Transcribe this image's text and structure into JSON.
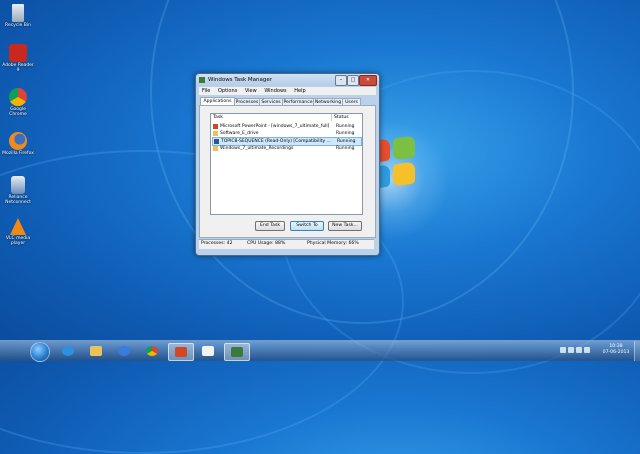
{
  "desktop": {
    "icons": [
      {
        "label": "Recycle Bin",
        "icon": "recycle-bin-icon"
      },
      {
        "label": "Adobe Reader 9",
        "icon": "adobe-reader-icon"
      },
      {
        "label": "Google Chrome",
        "icon": "chrome-icon"
      },
      {
        "label": "Mozilla Firefox",
        "icon": "firefox-icon"
      },
      {
        "label": "Reliance Netconnect",
        "icon": "netconnect-icon"
      },
      {
        "label": "VLC media player",
        "icon": "vlc-icon"
      }
    ]
  },
  "window": {
    "title": "Windows Task Manager",
    "menu": [
      "File",
      "Options",
      "View",
      "Windows",
      "Help"
    ],
    "tabs": [
      "Applications",
      "Processes",
      "Services",
      "Performance",
      "Networking",
      "Users"
    ],
    "active_tab": "Applications",
    "columns": {
      "task": "Task",
      "status": "Status"
    },
    "rows": [
      {
        "name": "Microsoft PowerPoint - [windows_7_ultimate_full]",
        "status": "Running"
      },
      {
        "name": "Software_E_drive",
        "status": "Running"
      },
      {
        "name": "TOPIC8-SEQUENCE (Read-Only) [Compatibility ...",
        "status": "Running"
      },
      {
        "name": "Windows_7_ultimate_Recordings",
        "status": "Running"
      }
    ],
    "buttons": {
      "end_task": "End Task",
      "switch_to": "Switch To",
      "new_task": "New Task..."
    },
    "status_bar": {
      "processes": "Processes: 42",
      "cpu": "CPU Usage: 88%",
      "memory": "Physical Memory: 66%"
    }
  },
  "taskbar": {
    "pinned": [
      "ie-icon",
      "explorer-icon",
      "media-player-icon",
      "chrome-icon",
      "powerpoint-icon",
      "paint-icon",
      "task-manager-icon"
    ],
    "clock_time": "10:38",
    "clock_date": "07-06-2013"
  },
  "colors": {
    "desktop": "#1a78d2",
    "window_frame": "#b9d1ea",
    "close_button": "#c94b3b"
  }
}
